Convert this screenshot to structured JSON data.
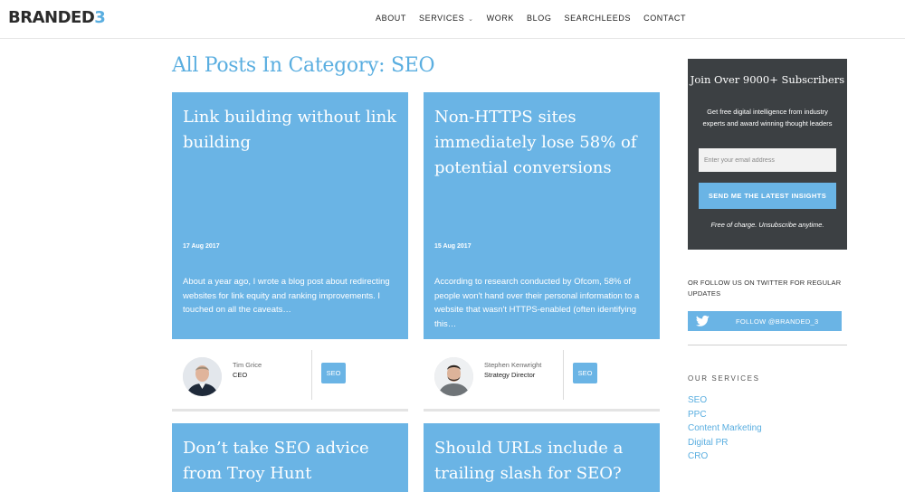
{
  "header": {
    "logo_text": "BRANDED",
    "logo_number": "3",
    "nav": [
      {
        "label": "ABOUT"
      },
      {
        "label": "SERVICES"
      },
      {
        "label": "WORK"
      },
      {
        "label": "BLOG"
      },
      {
        "label": "SEARCHLEEDS"
      },
      {
        "label": "CONTACT"
      }
    ]
  },
  "page": {
    "title": "All Posts In Category: SEO"
  },
  "posts": [
    {
      "title": "Link building without link building",
      "date": "17 Aug 2017",
      "excerpt": "About a year ago, I wrote a blog post about redirecting websites for link equity and ranking improvements. I touched on all the caveats…",
      "author_name": "Tim Grice",
      "author_role": "CEO",
      "tag": "SEO"
    },
    {
      "title": "Non-HTTPS sites immediately lose 58% of potential conversions",
      "date": "15 Aug 2017",
      "excerpt": "According to research conducted by Ofcom, 58% of people won't hand over their personal information to a website that wasn't HTTPS-enabled (often identifying this…",
      "author_name": "Stephen Kenwright",
      "author_role": "Strategy Director",
      "tag": "SEO"
    },
    {
      "title": "Don’t take SEO advice from Troy Hunt"
    },
    {
      "title": "Should URLs include a trailing slash for SEO?"
    }
  ],
  "sidebar": {
    "subscribe_title": "Join Over 9000+ Subscribers",
    "subscribe_desc": "Get free digital intelligence from industry experts and award winning thought leaders",
    "email_placeholder": "Enter your email address",
    "button_label": "SEND ME THE LATEST INSIGHTS",
    "note": "Free of charge. Unsubscribe anytime.",
    "follow_text": "OR FOLLOW US ON TWITTER FOR REGULAR UPDATES",
    "twitter_button": "FOLLOW @BRANDED_3",
    "services_heading": "OUR SERVICES",
    "services": [
      {
        "label": "SEO"
      },
      {
        "label": "PPC"
      },
      {
        "label": "Content Marketing"
      },
      {
        "label": "Digital PR"
      },
      {
        "label": "CRO"
      }
    ]
  },
  "colors": {
    "accent": "#6ab4e5",
    "title_blue": "#5aaee0",
    "subscribe_bg": "#3c4043"
  },
  "icons": [
    "chevron-down-icon",
    "twitter-bird-icon"
  ]
}
